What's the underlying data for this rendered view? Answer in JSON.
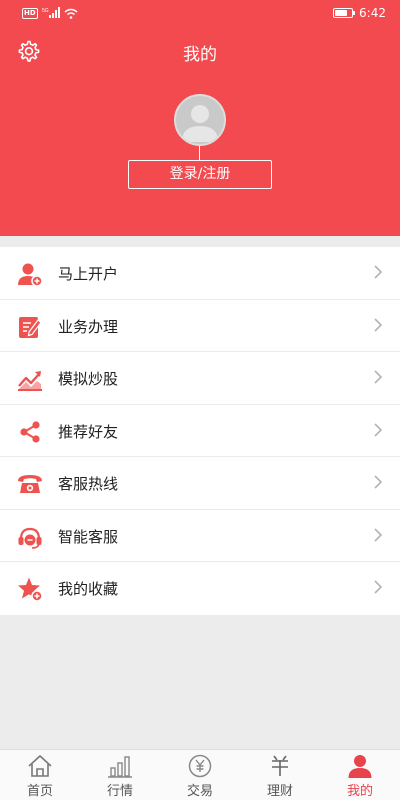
{
  "status_bar": {
    "network_badge": "HD",
    "network_type": "5G",
    "time": "6:42",
    "battery_level": 0.75
  },
  "header": {
    "title": "我的",
    "login_label": "登录/注册",
    "background_color": "#f24a4f"
  },
  "menu": {
    "items": [
      {
        "label": "马上开户",
        "icon": "person-add-icon"
      },
      {
        "label": "业务办理",
        "icon": "edit-document-icon"
      },
      {
        "label": "模拟炒股",
        "icon": "trend-chart-icon"
      },
      {
        "label": "推荐好友",
        "icon": "share-icon"
      },
      {
        "label": "客服热线",
        "icon": "telephone-icon"
      },
      {
        "label": "智能客服",
        "icon": "headset-icon"
      },
      {
        "label": "我的收藏",
        "icon": "star-icon"
      }
    ]
  },
  "tabbar": {
    "active_color": "#e8434c",
    "tabs": [
      {
        "label": "首页",
        "icon": "home-icon",
        "active": false
      },
      {
        "label": "行情",
        "icon": "bar-chart-icon",
        "active": false
      },
      {
        "label": "交易",
        "icon": "yuan-coin-icon",
        "active": false
      },
      {
        "label": "理财",
        "icon": "finance-icon",
        "active": false
      },
      {
        "label": "我的",
        "icon": "profile-icon",
        "active": true
      }
    ]
  }
}
